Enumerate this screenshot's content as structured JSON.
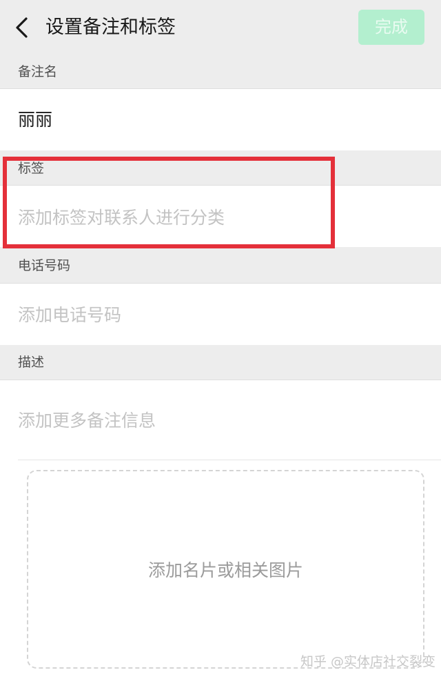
{
  "header": {
    "title": "设置备注和标签",
    "done_label": "完成"
  },
  "remark": {
    "label": "备注名",
    "value": "丽丽"
  },
  "tags": {
    "label": "标签",
    "placeholder": "添加标签对联系人进行分类"
  },
  "phone": {
    "label": "电话号码",
    "placeholder": "添加电话号码"
  },
  "description": {
    "label": "描述",
    "placeholder": "添加更多备注信息"
  },
  "photo": {
    "placeholder": "添加名片或相关图片"
  },
  "watermark": "知乎 @实体店社交裂变",
  "colors": {
    "accent_disabled": "#b3efcf",
    "highlight": "#e4303a",
    "background": "#ededed"
  }
}
